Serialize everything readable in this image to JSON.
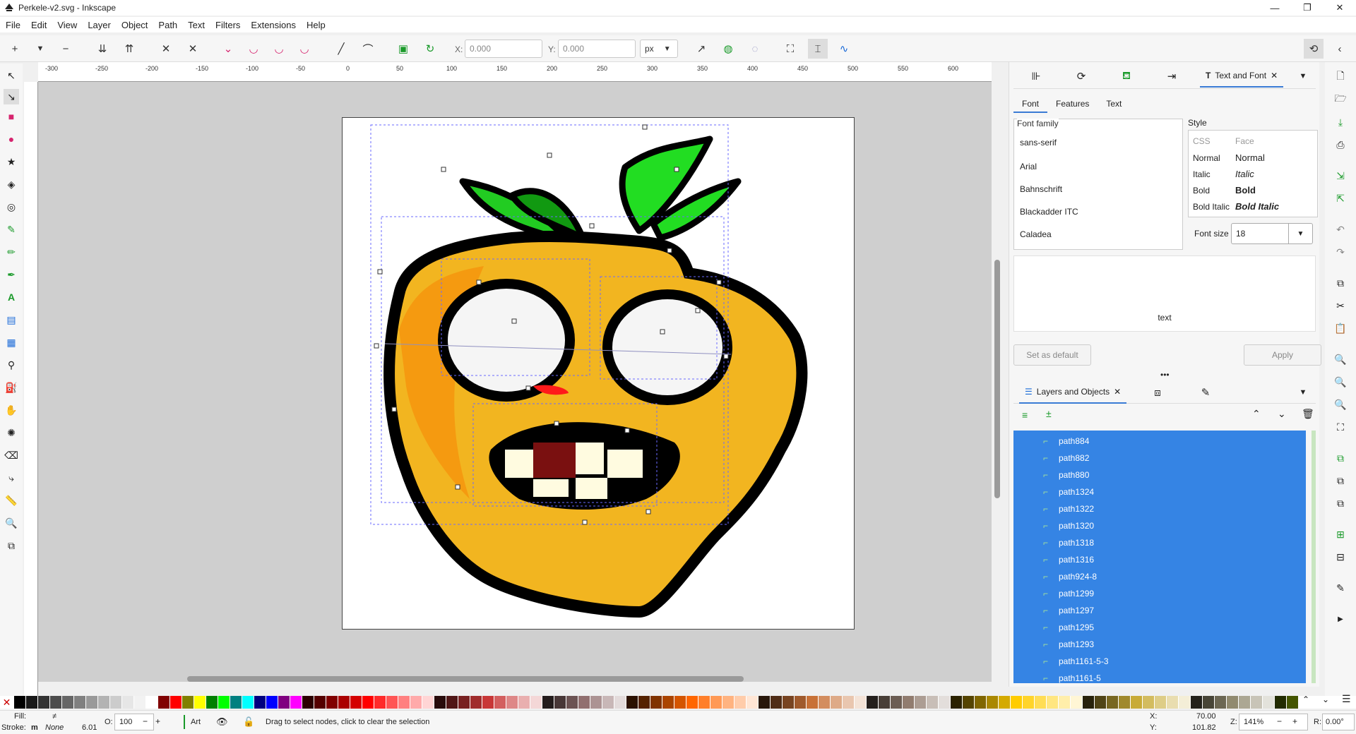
{
  "window": {
    "title": "Perkele-v2.svg - Inkscape",
    "controls": [
      "—",
      "❐",
      "✕"
    ]
  },
  "menu": [
    "File",
    "Edit",
    "View",
    "Layer",
    "Object",
    "Path",
    "Text",
    "Filters",
    "Extensions",
    "Help"
  ],
  "toolbar": {
    "x_label": "X:",
    "x_value": "0.000",
    "y_label": "Y:",
    "y_value": "0.000",
    "unit": "px"
  },
  "ruler": {
    "ticks": [
      "-300",
      "-250",
      "-200",
      "-150",
      "-100",
      "-50",
      "0",
      "50",
      "100",
      "150",
      "200",
      "250",
      "300",
      "350",
      "400",
      "450",
      "500",
      "550",
      "600"
    ]
  },
  "text_font_panel": {
    "tab_title": "Text and Font",
    "subtabs": [
      "Font",
      "Features",
      "Text"
    ],
    "font_family_label": "Font family",
    "font_family_value": "sans-serif",
    "font_families": [
      "Arial",
      "Bahnschrift",
      "Blackadder ITC",
      "Caladea"
    ],
    "style_label": "Style",
    "style_columns": [
      "CSS",
      "Face"
    ],
    "styles": [
      {
        "css": "Normal",
        "face": "Normal"
      },
      {
        "css": "Italic",
        "face": "Italic"
      },
      {
        "css": "Bold",
        "face": "Bold"
      },
      {
        "css": "Bold Italic",
        "face": "Bold Italic"
      }
    ],
    "font_size_label": "Font size",
    "font_size_value": "18",
    "preview_text": "text",
    "set_default_label": "Set as default",
    "apply_label": "Apply"
  },
  "layers_panel": {
    "tab_title": "Layers and Objects",
    "items": [
      "path884",
      "path882",
      "path880",
      "path1324",
      "path1322",
      "path1320",
      "path1318",
      "path1316",
      "path924-8",
      "path1299",
      "path1297",
      "path1295",
      "path1293",
      "path1161-5-3",
      "path1161-5"
    ]
  },
  "palette": [
    "#000000",
    "#1a1a1a",
    "#333333",
    "#4d4d4d",
    "#666666",
    "#808080",
    "#999999",
    "#b3b3b3",
    "#cccccc",
    "#e6e6e6",
    "#f2f2f2",
    "#ffffff",
    "#800000",
    "#ff0000",
    "#808000",
    "#ffff00",
    "#008000",
    "#00ff00",
    "#008080",
    "#00ffff",
    "#000080",
    "#0000ff",
    "#800080",
    "#ff00ff",
    "#2b0000",
    "#550000",
    "#800000",
    "#aa0000",
    "#d40000",
    "#ff0000",
    "#ff2a2a",
    "#ff5555",
    "#ff8080",
    "#ffaaaa",
    "#ffd5d5",
    "#280b0b",
    "#501616",
    "#782121",
    "#a02c2c",
    "#c83737",
    "#d35f5f",
    "#de8787",
    "#e9afaf",
    "#f4d7d7",
    "#241c1c",
    "#483737",
    "#6c5353",
    "#916f6f",
    "#ac9393",
    "#c8b7b7",
    "#e3dbdb",
    "#2b1100",
    "#552200",
    "#803300",
    "#aa4400",
    "#d45500",
    "#ff6600",
    "#ff7f2a",
    "#ff9955",
    "#ffb380",
    "#ffccaa",
    "#ffe6d5",
    "#28170b",
    "#502d16",
    "#784421",
    "#a05a2c",
    "#c87137",
    "#d38d5f",
    "#deaa87",
    "#e9c6af",
    "#f4e3d7",
    "#241f1c",
    "#483e37",
    "#6c5d53",
    "#917c6f",
    "#ac9d93",
    "#c8beb7",
    "#e3dedb",
    "#2b2200",
    "#554400",
    "#806600",
    "#aa8800",
    "#d4aa00",
    "#ffcc00",
    "#ffd42a",
    "#ffdd55",
    "#ffe680",
    "#ffeeaa",
    "#fff6d5",
    "#28220b",
    "#504416",
    "#786721",
    "#a0892c",
    "#c8ab37",
    "#d3bc5f",
    "#decd87",
    "#e9ddaf",
    "#f4eed7",
    "#24221c",
    "#484537",
    "#6c6753",
    "#918a6f",
    "#aca793",
    "#c8c4b7",
    "#e3e2db",
    "#222b00",
    "#445500"
  ],
  "status": {
    "fill_label": "Fill:",
    "fill_value": "≠",
    "stroke_label": "Stroke:",
    "stroke_value": "m",
    "stroke_none": "None",
    "stroke_width": "6.01",
    "opacity_label": "O:",
    "opacity_value": "100",
    "layer_name": "Art",
    "message": "Drag to select nodes, click to clear the selection",
    "x_label": "X:",
    "x_value": "70.00",
    "y_label": "Y:",
    "y_value": "101.82",
    "zoom_label": "Z:",
    "zoom_value": "141%",
    "rotation_label": "R:",
    "rotation_value": "0.00°"
  }
}
